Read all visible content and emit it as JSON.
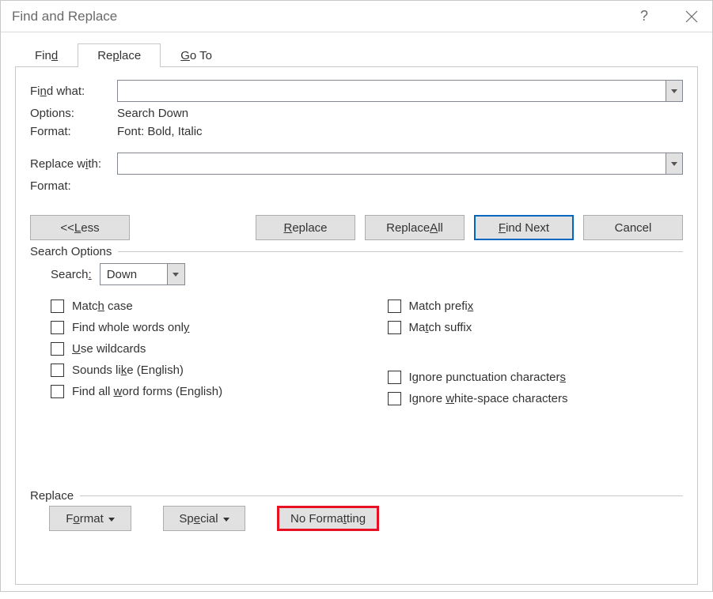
{
  "window": {
    "title": "Find and Replace"
  },
  "tabs": {
    "find": "Find",
    "replace": "Replace",
    "goto": "Go To",
    "find_ul": "d",
    "replace_ul": "P",
    "goto_ul": "G"
  },
  "labels": {
    "find_what": "Find what:",
    "options": "Options:",
    "format": "Format:",
    "replace_with": "Replace with:",
    "format2": "Format:",
    "search_options": "Search Options",
    "search": "Search:",
    "replace_group": "Replace"
  },
  "values": {
    "find_what": "",
    "options": "Search Down",
    "find_format": "Font: Bold, Italic",
    "replace_with": "",
    "replace_format": "",
    "search_direction": "Down"
  },
  "buttons": {
    "less": "<< Less",
    "replace": "Replace",
    "replace_all": "Replace All",
    "find_next": "Find Next",
    "cancel": "Cancel",
    "format": "Format",
    "special": "Special",
    "no_formatting": "No Formatting"
  },
  "checkboxes": {
    "match_case": "Match case",
    "find_whole_words": "Find whole words only",
    "use_wildcards": "Use wildcards",
    "sounds_like": "Sounds like (English)",
    "find_all_word_forms": "Find all word forms (English)",
    "match_prefix": "Match prefix",
    "match_suffix": "Match suffix",
    "ignore_punct": "Ignore punctuation characters",
    "ignore_ws": "Ignore white-space characters"
  }
}
